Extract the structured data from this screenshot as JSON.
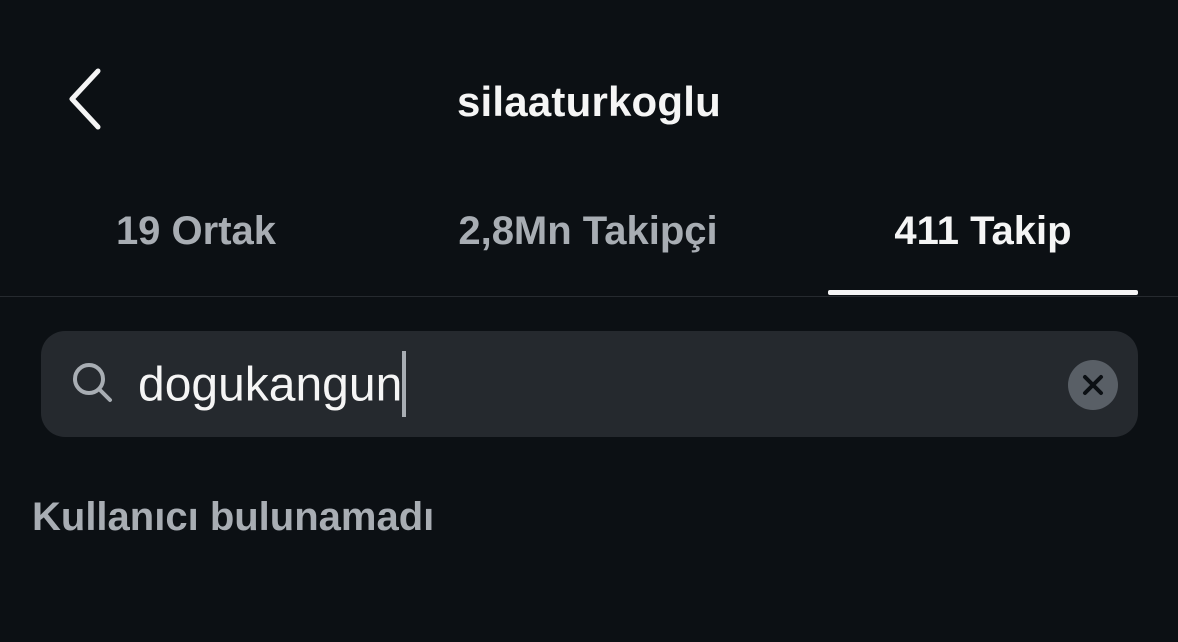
{
  "header": {
    "title": "silaaturkoglu",
    "back_icon": "chevron-left-icon"
  },
  "tabs": [
    {
      "label": "19 Ortak",
      "active": false
    },
    {
      "label": "2,8Mn Takipçi",
      "active": false
    },
    {
      "label": "411 Takip",
      "active": true
    }
  ],
  "search": {
    "value": "dogukangun",
    "icon": "search-icon",
    "clear_icon": "close-icon"
  },
  "results": {
    "empty_message": "Kullanıcı bulunamadı"
  },
  "colors": {
    "background": "#0c1014",
    "text": "#f5f5f5",
    "muted": "#a8adb3",
    "search_bg": "#25292e"
  }
}
